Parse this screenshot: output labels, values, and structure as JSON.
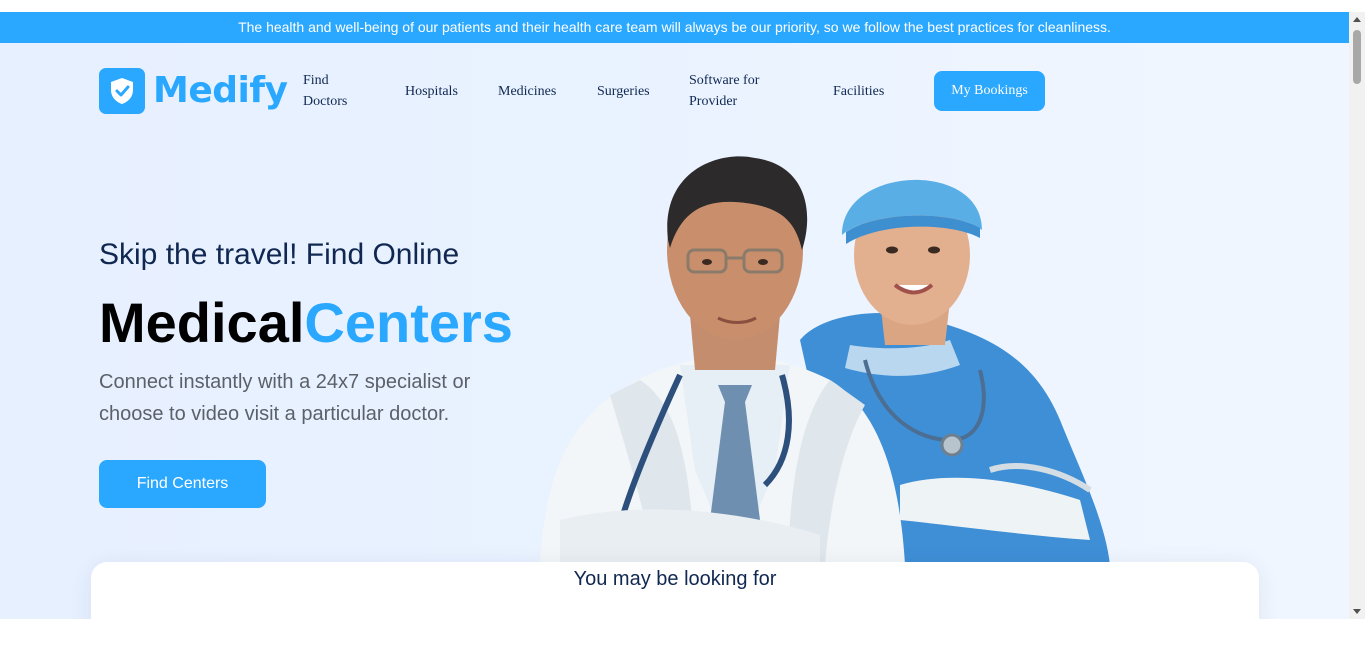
{
  "banner": {
    "text": "The health and well-being of our patients and their health care team will always be our priority, so we follow the best practices for cleanliness."
  },
  "brand": {
    "name": "Medify",
    "color": "#2aa7ff",
    "icon": "shield-check-icon"
  },
  "nav": {
    "items": [
      {
        "label": "Find\nDoctors"
      },
      {
        "label": "Hospitals"
      },
      {
        "label": "Medicines"
      },
      {
        "label": "Surgeries"
      },
      {
        "label": "Software for\nProvider"
      },
      {
        "label": "Facilities"
      }
    ],
    "cta_label": "My Bookings"
  },
  "hero": {
    "subtitle": "Skip the travel! Find Online",
    "title_part1": "Medical",
    "title_part2": "Centers",
    "description": "Connect instantly with a 24x7 specialist or choose to video visit a particular doctor.",
    "button_label": "Find Centers",
    "image": "doctor-and-nurse-illustration"
  },
  "search_card": {
    "title": "You may be looking for"
  },
  "colors": {
    "accent": "#2aa7ff",
    "text_dark": "#102851",
    "text_muted": "#5c6169"
  }
}
